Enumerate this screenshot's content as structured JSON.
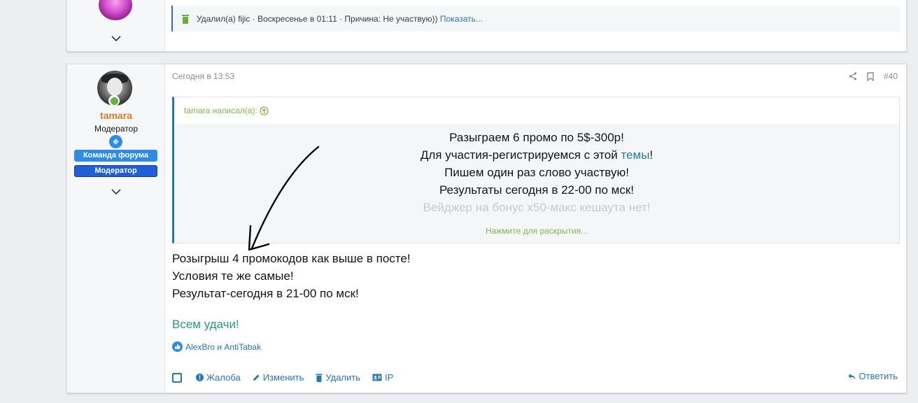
{
  "previous_post": {
    "deleted_text": "Удалил(а) fijic · Воскресенье в 01:11 · Причина: Не участвую))",
    "show_link": "Показать..."
  },
  "post": {
    "date": "Сегодня в 13:53",
    "number": "#40",
    "user": {
      "name": "tamara",
      "title": "Модератор",
      "banners": [
        "Команда форума",
        "Модератор"
      ]
    },
    "quote": {
      "header": "tamara написал(а):",
      "lines": [
        {
          "text": "Разыграем 6 промо по 5$-300р!"
        },
        {
          "before": "Для участия-регистрируемся с этой ",
          "link": "темы",
          "after": "!"
        },
        {
          "text": "Пишем один раз слово участвую!"
        },
        {
          "text": "Результаты сегодня в 22-00 по мск!"
        },
        {
          "text": "Вейджер на бонус x50-макс кешаута нет!"
        }
      ],
      "expand": "Нажмите для раскрытия..."
    },
    "body_lines": [
      "Розыгрыш 4 промокодов как выше в посте!",
      "Условия те же самые!",
      "Результат-сегодня в 21-00 по мск!"
    ],
    "greeting": "Всем удачи!",
    "likes": "AlexBro и AntiTabak",
    "actions": {
      "report": "Жалоба",
      "edit": "Изменить",
      "delete": "Удалить",
      "ip": "IP",
      "reply": "Ответить"
    }
  },
  "colors": {
    "link": "#2577b1",
    "username": "#e07b2a",
    "quote_header": "#83b551",
    "greeting": "#2b9a7a",
    "trash": "#63b343"
  }
}
